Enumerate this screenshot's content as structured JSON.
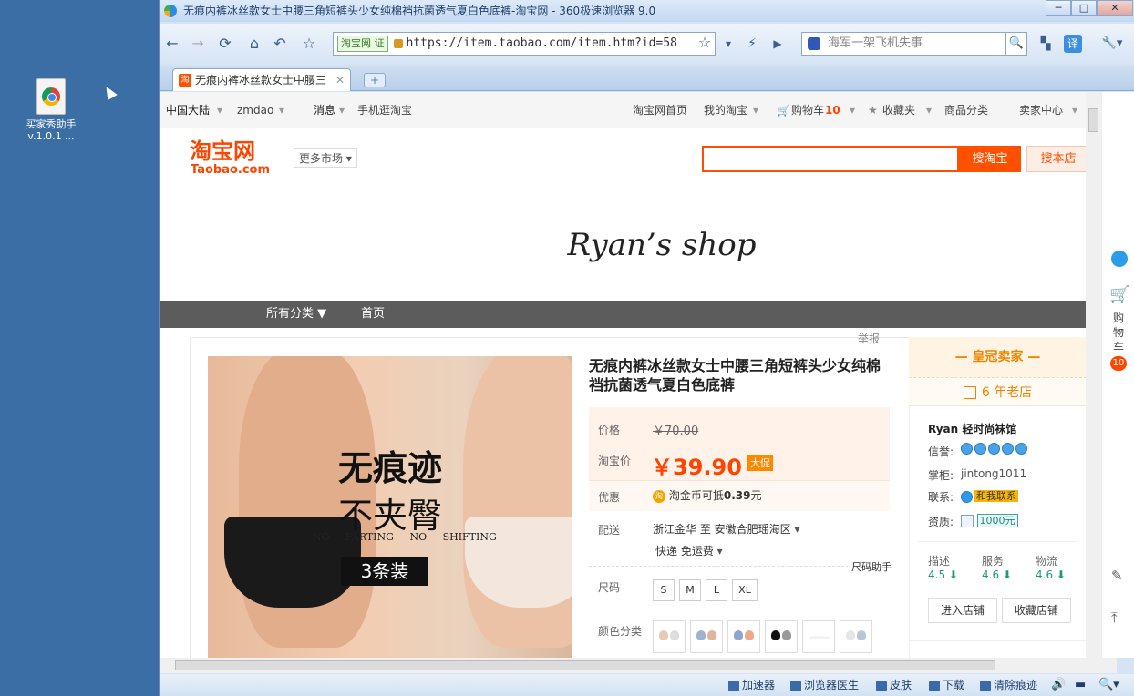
{
  "desktop": {
    "icon_label_1": "买家秀助手",
    "icon_label_2": "v.1.0.1 ..."
  },
  "window": {
    "title": "无痕内裤冰丝款女士中腰三角短裤头少女纯棉裆抗菌透气夏白色底裤-淘宝网 - 360极速浏览器 9.0",
    "min": "─",
    "max": "□",
    "close": "✕"
  },
  "toolbar": {
    "back": "←",
    "forward": "→",
    "refresh": "⟳",
    "home": "⌂",
    "undo": "↶",
    "star": "☆",
    "site_badge": "淘宝网",
    "cert_badge": "证",
    "url": "https://item.taobao.com/item.htm?id=58",
    "bookmark": "☆",
    "dropdown": "▾",
    "lightning": "⚡",
    "play": "▶",
    "search_placeholder": "海军一架飞机失事",
    "search_btn": "🔍",
    "ext1": "▚",
    "translate": "译",
    "tools": "🔧▾"
  },
  "tab": {
    "favicon": "淘",
    "title": "无痕内裤冰丝款女士中腰三",
    "close": "✕",
    "new_tab": "+"
  },
  "taobao": {
    "topnav": {
      "region": "中国大陆",
      "user": "zmdao",
      "messages": "消息",
      "mobile": "手机逛淘宝",
      "home": "淘宝网首页",
      "my_taobao": "我的淘宝",
      "cart": "购物车",
      "cart_count": "10",
      "favorites": "收藏夹",
      "categories": "商品分类",
      "seller_center": "卖家中心"
    },
    "logo_cn": "淘宝网",
    "logo_en": "Taobao.com",
    "more_market": "更多市场",
    "search_btn": "搜淘宝",
    "shop_search_btn": "搜本店",
    "shop_name": "Ryan’s  shop",
    "catbar": {
      "all_categories": "所有分类 ▼",
      "home": "首页"
    },
    "report": "举报",
    "product_image": {
      "line1": "无痕迹",
      "line2": "不夹臀",
      "english": "NO FARTING NO SHIFTING",
      "pack": "3条装"
    },
    "product": {
      "title": "无痕内裤冰丝款女士中腰三角短裤头少女纯棉裆抗菌透气夏白色底裤",
      "price_label": "价格",
      "orig_price": "￥70.00",
      "tb_price_label": "淘宝价",
      "price": "￥39.90",
      "promo": "大促",
      "youhui_label": "优惠",
      "coin_icon": "淘",
      "youhui_text": "淘金币可抵",
      "youhui_amount": "0.39",
      "youhui_unit": "元",
      "ship_label": "配送",
      "ship_from": "浙江金华 至  安徽合肥瑶海区",
      "ship_fee": "快递 免运费",
      "size_helper": "尺码助手",
      "size_label": "尺码",
      "sizes": [
        "S",
        "M",
        "L",
        "XL"
      ],
      "color_label": "颜色分类"
    },
    "shop_side": {
      "crown": "— 皇冠卖家 —",
      "old_shop": "6 年老店",
      "shop_title": "Ryan 轻时尚袜馆",
      "credit_label": "信誉:",
      "keeper_label": "掌柜:",
      "keeper": "jintong1011",
      "contact_label": "联系:",
      "contact_btn": "和我联系",
      "qual_label": "资质:",
      "deposit": "1000元",
      "desc_label": "描述",
      "desc_score": "4.5",
      "service_label": "服务",
      "service_score": "4.6",
      "logistics_label": "物流",
      "logistics_score": "4.6",
      "enter_shop": "进入店铺",
      "fav_shop": "收藏店铺"
    },
    "rightbar": {
      "cart_label": "购物车",
      "cart_count": "10"
    }
  },
  "statusbar": {
    "accelerator": "加速器",
    "doctor": "浏览器医生",
    "skin": "皮肤",
    "download": "下载",
    "clear": "清除痕迹"
  }
}
